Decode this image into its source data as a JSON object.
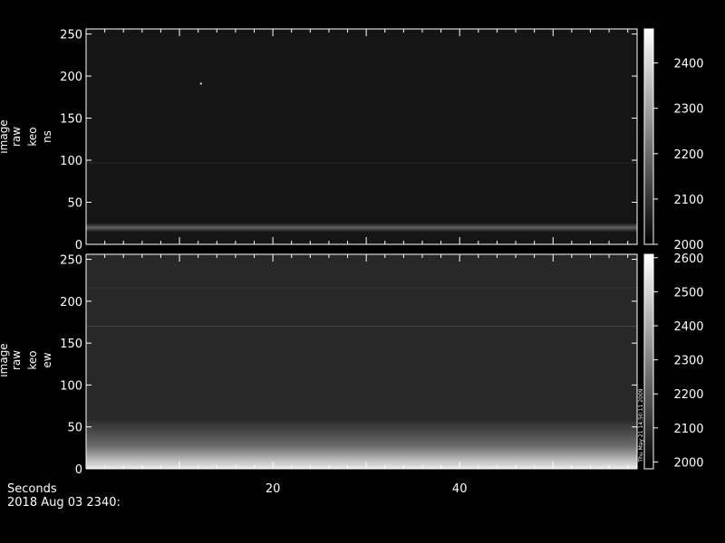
{
  "chart_data": [
    {
      "type": "heatmap",
      "ylabel_lines": [
        "image",
        "raw",
        "keo",
        "ns"
      ],
      "yticks": [
        0,
        50,
        100,
        150,
        200,
        250
      ],
      "ylim": [
        0,
        256
      ],
      "xlim": [
        0,
        59
      ],
      "colorbar_ticks": [
        2000,
        2100,
        2200,
        2300,
        2400
      ],
      "colorbar_range": [
        2000,
        2475
      ],
      "background_level": 2040,
      "features": [
        {
          "y": 20,
          "value": 2180,
          "kind": "horizontal-band"
        },
        {
          "y": 97,
          "value": 2080,
          "kind": "horizontal-line"
        }
      ],
      "points": [
        {
          "x": 12.3,
          "y": 191,
          "value": 2420
        }
      ]
    },
    {
      "type": "heatmap",
      "ylabel_lines": [
        "image",
        "raw",
        "keo",
        "ew"
      ],
      "yticks": [
        0,
        50,
        100,
        150,
        200,
        250
      ],
      "ylim": [
        0,
        256
      ],
      "xlim": [
        0,
        59
      ],
      "colorbar_ticks": [
        2000,
        2100,
        2200,
        2300,
        2400,
        2500,
        2600
      ],
      "colorbar_range": [
        1980,
        2610
      ],
      "background_level": 2080,
      "features": [
        {
          "y": 5,
          "value": 2560,
          "kind": "bright-bottom-gradient"
        },
        {
          "y": 170,
          "value": 2150,
          "kind": "horizontal-line"
        },
        {
          "y": 216,
          "value": 2110,
          "kind": "horizontal-line"
        }
      ],
      "colorbar_note": "Thu May 21 14:50:11 2009"
    }
  ],
  "xaxis": {
    "label": "Seconds",
    "ticks": [
      20,
      40
    ],
    "date_label": "2018 Aug 03 2340:"
  }
}
